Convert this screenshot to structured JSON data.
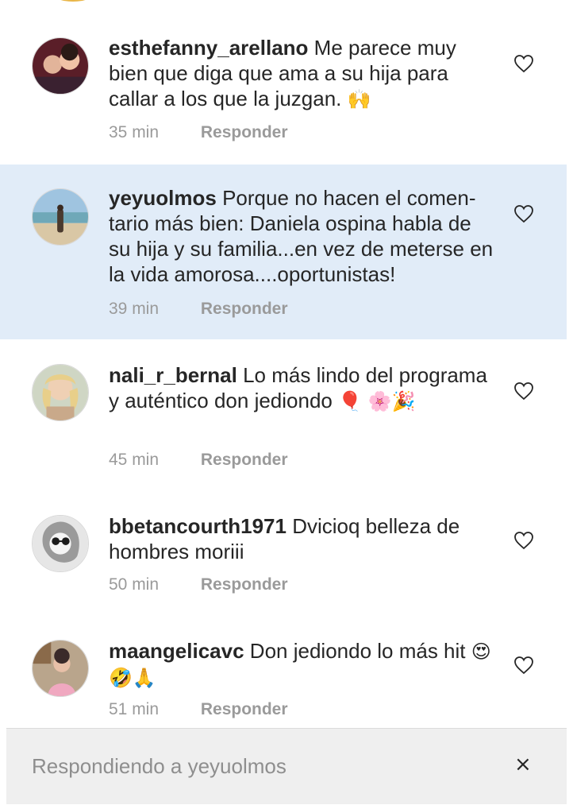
{
  "comments": [
    {
      "username": "esthefanny_arellano",
      "text": "Me parece muy bien que diga que ama a su hija para callar a los que la juzgan.",
      "emoji": "🙌",
      "time": "35 min",
      "reply_label": "Responder"
    },
    {
      "username": "yeyuolmos",
      "text": "Porque no hacen el comen-tario más bien: Daniela ospina habla de su hija y su familia...en vez de meterse en la vida amorosa....oportunistas!",
      "emoji": "",
      "time": "39 min",
      "reply_label": "Responder"
    },
    {
      "username": "nali_r_bernal",
      "text": "Lo más lindo del programa y auténtico don jediondo",
      "emoji": "🎈 🌸🎉",
      "time": "45 min",
      "reply_label": "Responder"
    },
    {
      "username": "bbetancourth1971",
      "text": "Dvicioq belleza de hombres moriii",
      "emoji": "",
      "time": "50 min",
      "reply_label": "Responder"
    },
    {
      "username": "maangelicavc",
      "text": "Don jediondo lo más hit",
      "emoji": "😍🤣🙏",
      "time": "51 min",
      "reply_label": "Responder"
    }
  ],
  "reply_bar": {
    "label": "Respondiendo a yeyuolmos",
    "close_glyph": "×"
  },
  "icons": {
    "like": "heart-outline-icon",
    "close": "close-icon"
  },
  "colors": {
    "highlight": "#e1ecf8",
    "meta_text": "#9a9a9a",
    "reply_bar_bg": "#efefef"
  }
}
